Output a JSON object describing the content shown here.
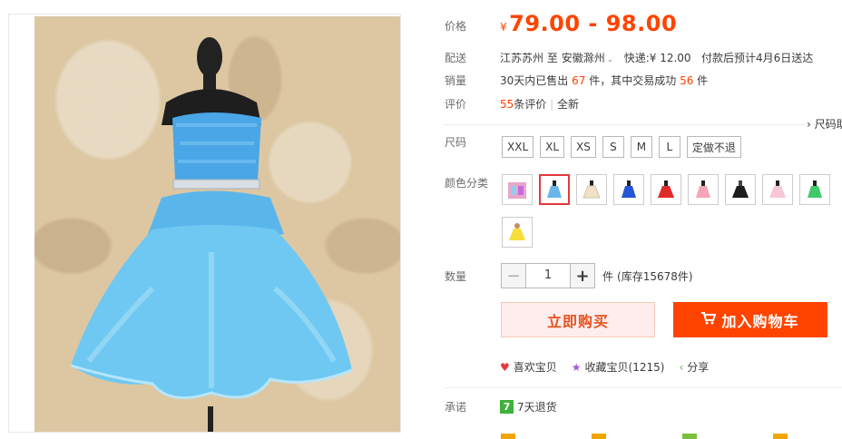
{
  "product": {
    "image_alt": "blue tulle feather strapless dress on mannequin"
  },
  "price": {
    "label": "价格",
    "currency": "¥",
    "range": "79.00 - 98.00"
  },
  "shipping": {
    "label": "配送",
    "from": "江苏苏州",
    "to_word": "至",
    "destination": "安徽滁州",
    "express": "快递:¥ 12.00",
    "eta": "付款后预计4月6日送达"
  },
  "sales": {
    "label": "销量",
    "prefix": "30天内已售出",
    "sold": "67",
    "mid": "件，其中交易成功",
    "success": "56",
    "suffix": "件"
  },
  "reviews": {
    "label": "评价",
    "count": "55",
    "unit": "条评价",
    "separator": "|",
    "all": "全新"
  },
  "size_chart_link": "› 尺码助",
  "size": {
    "label": "尺码",
    "options": [
      "XXL",
      "XL",
      "XS",
      "S",
      "M",
      "L",
      "定做不退"
    ]
  },
  "color": {
    "label": "颜色分类",
    "swatches": [
      {
        "name": "multi-color-set",
        "color": "#e9a6c8"
      },
      {
        "name": "light-blue",
        "color": "#69b6ea"
      },
      {
        "name": "champagne",
        "color": "#efe2c9"
      },
      {
        "name": "royal-blue",
        "color": "#2556d6"
      },
      {
        "name": "red",
        "color": "#e02a2a"
      },
      {
        "name": "pink",
        "color": "#f5a5b8"
      },
      {
        "name": "black",
        "color": "#1d1d1d"
      },
      {
        "name": "light-pink",
        "color": "#f7c6d8"
      },
      {
        "name": "green",
        "color": "#3ec96a"
      },
      {
        "name": "yellow",
        "color": "#f6de3b"
      }
    ]
  },
  "quantity": {
    "label": "数量",
    "minus": "−",
    "value": "1",
    "plus": "+",
    "unit": "件",
    "stock": "(库存15678件)"
  },
  "buttons": {
    "buy_now": "立即购买",
    "add_to_cart": "加入购物车"
  },
  "actions": {
    "like": "喜欢宝贝",
    "favorite": "收藏宝贝(1215)",
    "share": "分享"
  },
  "promise": {
    "label": "承诺",
    "badge": "7",
    "text": "7天退货"
  },
  "colors": {
    "accent": "#ff4400",
    "buy_bg": "#ffeded",
    "dress_blue": "#6cc5ee"
  }
}
